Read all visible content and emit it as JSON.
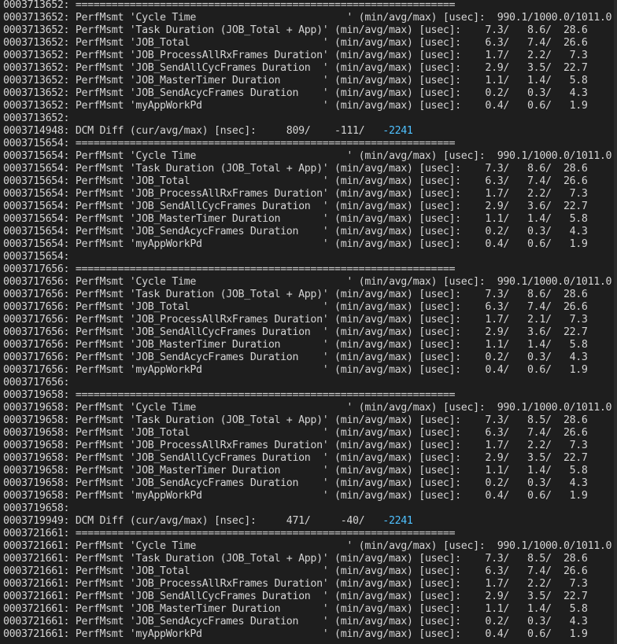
{
  "colors": {
    "background": "#1e1e1e",
    "text": "#d4d4d4",
    "highlight": "#4fc1ff"
  },
  "terminal": {
    "lines": [
      {
        "text": "0003713652: ==============================================================="
      },
      {
        "text": "0003713652: PerfMsmt 'Cycle Time                         ' (min/avg/max) [usec]:  990.1/1000.0/1011.0"
      },
      {
        "text": "0003713652: PerfMsmt 'Task Duration (JOB_Total + App)' (min/avg/max) [usec]:    7.3/   8.6/  28.6"
      },
      {
        "text": "0003713652: PerfMsmt 'JOB_Total                      ' (min/avg/max) [usec]:    6.3/   7.4/  26.6"
      },
      {
        "text": "0003713652: PerfMsmt 'JOB_ProcessAllRxFrames Duration' (min/avg/max) [usec]:    1.7/   2.2/   7.3"
      },
      {
        "text": "0003713652: PerfMsmt 'JOB_SendAllCycFrames Duration  ' (min/avg/max) [usec]:    2.9/   3.5/  22.7"
      },
      {
        "text": "0003713652: PerfMsmt 'JOB_MasterTimer Duration       ' (min/avg/max) [usec]:    1.1/   1.4/   5.8"
      },
      {
        "text": "0003713652: PerfMsmt 'JOB_SendAcycFrames Duration    ' (min/avg/max) [usec]:    0.2/   0.3/   4.3"
      },
      {
        "text": "0003713652: PerfMsmt 'myAppWorkPd                    ' (min/avg/max) [usec]:    0.4/   0.6/   1.9"
      },
      {
        "text": "0003713652:"
      },
      {
        "text": "0003714948: DCM Diff (cur/avg/max) [nsec]:     809/    -111/   ",
        "highlight": "-2241"
      },
      {
        "text": "0003715654: ==============================================================="
      },
      {
        "text": "0003715654: PerfMsmt 'Cycle Time                         ' (min/avg/max) [usec]:  990.1/1000.0/1011.0"
      },
      {
        "text": "0003715654: PerfMsmt 'Task Duration (JOB_Total + App)' (min/avg/max) [usec]:    7.3/   8.6/  28.6"
      },
      {
        "text": "0003715654: PerfMsmt 'JOB_Total                      ' (min/avg/max) [usec]:    6.3/   7.4/  26.6"
      },
      {
        "text": "0003715654: PerfMsmt 'JOB_ProcessAllRxFrames Duration' (min/avg/max) [usec]:    1.7/   2.2/   7.3"
      },
      {
        "text": "0003715654: PerfMsmt 'JOB_SendAllCycFrames Duration  ' (min/avg/max) [usec]:    2.9/   3.6/  22.7"
      },
      {
        "text": "0003715654: PerfMsmt 'JOB_MasterTimer Duration       ' (min/avg/max) [usec]:    1.1/   1.4/   5.8"
      },
      {
        "text": "0003715654: PerfMsmt 'JOB_SendAcycFrames Duration    ' (min/avg/max) [usec]:    0.2/   0.3/   4.3"
      },
      {
        "text": "0003715654: PerfMsmt 'myAppWorkPd                    ' (min/avg/max) [usec]:    0.4/   0.6/   1.9"
      },
      {
        "text": "0003715654:"
      },
      {
        "text": "0003717656: ==============================================================="
      },
      {
        "text": "0003717656: PerfMsmt 'Cycle Time                         ' (min/avg/max) [usec]:  990.1/1000.0/1011.0"
      },
      {
        "text": "0003717656: PerfMsmt 'Task Duration (JOB_Total + App)' (min/avg/max) [usec]:    7.3/   8.6/  28.6"
      },
      {
        "text": "0003717656: PerfMsmt 'JOB_Total                      ' (min/avg/max) [usec]:    6.3/   7.4/  26.6"
      },
      {
        "text": "0003717656: PerfMsmt 'JOB_ProcessAllRxFrames Duration' (min/avg/max) [usec]:    1.7/   2.1/   7.3"
      },
      {
        "text": "0003717656: PerfMsmt 'JOB_SendAllCycFrames Duration  ' (min/avg/max) [usec]:    2.9/   3.6/  22.7"
      },
      {
        "text": "0003717656: PerfMsmt 'JOB_MasterTimer Duration       ' (min/avg/max) [usec]:    1.1/   1.4/   5.8"
      },
      {
        "text": "0003717656: PerfMsmt 'JOB_SendAcycFrames Duration    ' (min/avg/max) [usec]:    0.2/   0.3/   4.3"
      },
      {
        "text": "0003717656: PerfMsmt 'myAppWorkPd                    ' (min/avg/max) [usec]:    0.4/   0.6/   1.9"
      },
      {
        "text": "0003717656:"
      },
      {
        "text": "0003719658: ==============================================================="
      },
      {
        "text": "0003719658: PerfMsmt 'Cycle Time                         ' (min/avg/max) [usec]:  990.1/1000.0/1011.0"
      },
      {
        "text": "0003719658: PerfMsmt 'Task Duration (JOB_Total + App)' (min/avg/max) [usec]:    7.3/   8.5/  28.6"
      },
      {
        "text": "0003719658: PerfMsmt 'JOB_Total                      ' (min/avg/max) [usec]:    6.3/   7.4/  26.6"
      },
      {
        "text": "0003719658: PerfMsmt 'JOB_ProcessAllRxFrames Duration' (min/avg/max) [usec]:    1.7/   2.2/   7.3"
      },
      {
        "text": "0003719658: PerfMsmt 'JOB_SendAllCycFrames Duration  ' (min/avg/max) [usec]:    2.9/   3.5/  22.7"
      },
      {
        "text": "0003719658: PerfMsmt 'JOB_MasterTimer Duration       ' (min/avg/max) [usec]:    1.1/   1.4/   5.8"
      },
      {
        "text": "0003719658: PerfMsmt 'JOB_SendAcycFrames Duration    ' (min/avg/max) [usec]:    0.2/   0.3/   4.3"
      },
      {
        "text": "0003719658: PerfMsmt 'myAppWorkPd                    ' (min/avg/max) [usec]:    0.4/   0.6/   1.9"
      },
      {
        "text": "0003719658:"
      },
      {
        "text": "0003719949: DCM Diff (cur/avg/max) [nsec]:     471/     -40/   ",
        "highlight": "-2241"
      },
      {
        "text": "0003721661: ==============================================================="
      },
      {
        "text": "0003721661: PerfMsmt 'Cycle Time                         ' (min/avg/max) [usec]:  990.1/1000.0/1011.0"
      },
      {
        "text": "0003721661: PerfMsmt 'Task Duration (JOB_Total + App)' (min/avg/max) [usec]:    7.3/   8.5/  28.6"
      },
      {
        "text": "0003721661: PerfMsmt 'JOB_Total                      ' (min/avg/max) [usec]:    6.3/   7.4/  26.6"
      },
      {
        "text": "0003721661: PerfMsmt 'JOB_ProcessAllRxFrames Duration' (min/avg/max) [usec]:    1.7/   2.2/   7.3"
      },
      {
        "text": "0003721661: PerfMsmt 'JOB_SendAllCycFrames Duration  ' (min/avg/max) [usec]:    2.9/   3.5/  22.7"
      },
      {
        "text": "0003721661: PerfMsmt 'JOB_MasterTimer Duration       ' (min/avg/max) [usec]:    1.1/   1.4/   5.8"
      },
      {
        "text": "0003721661: PerfMsmt 'JOB_SendAcycFrames Duration    ' (min/avg/max) [usec]:    0.2/   0.3/   4.3"
      },
      {
        "text": "0003721661: PerfMsmt 'myAppWorkPd                    ' (min/avg/max) [usec]:    0.4/   0.6/   1.9"
      }
    ]
  }
}
